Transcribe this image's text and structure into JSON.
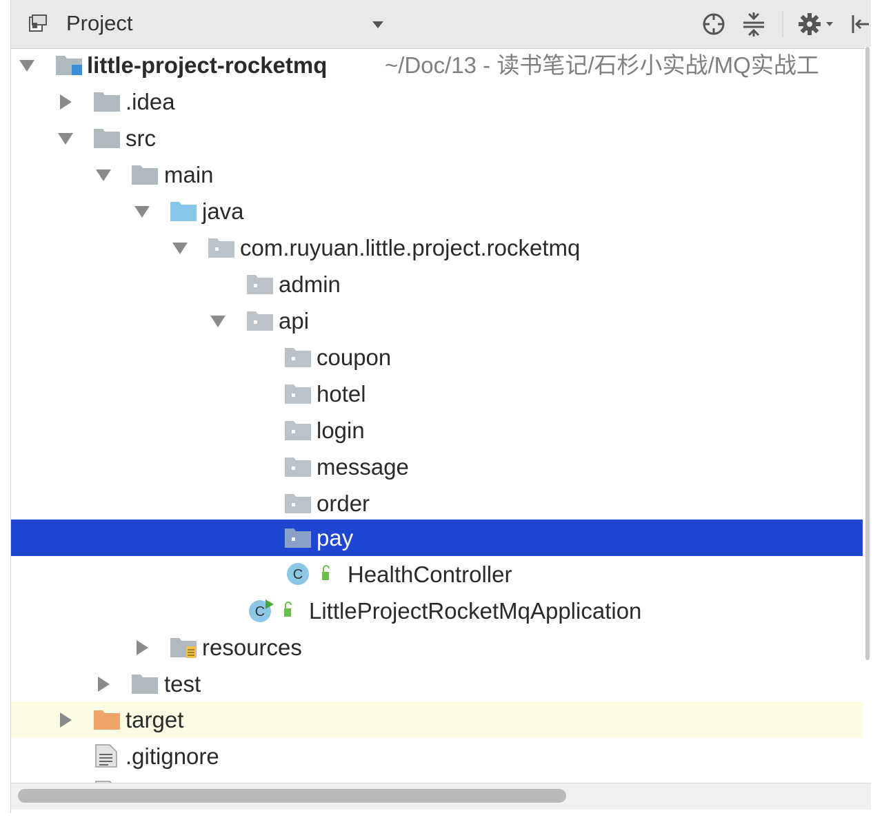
{
  "toolbar": {
    "title": "Project",
    "icons": [
      "project-view-icon",
      "dropdown-arrow-icon",
      "locate-icon",
      "collapse-all-icon",
      "gear-icon",
      "hide-panel-icon"
    ]
  },
  "tree": {
    "rows": [
      {
        "label": "little-project-rocketmq",
        "path": " ~/Doc/13 - 读书笔记/石杉小实战/MQ实战工",
        "arrow": "expanded",
        "icon": "module-folder-icon"
      },
      {
        "label": ".idea",
        "arrow": "collapsed",
        "icon": "folder-icon"
      },
      {
        "label": "src",
        "arrow": "expanded",
        "icon": "folder-icon"
      },
      {
        "label": "main",
        "arrow": "expanded",
        "icon": "folder-icon"
      },
      {
        "label": "java",
        "arrow": "expanded",
        "icon": "source-root-folder-icon"
      },
      {
        "label": "com.ruyuan.little.project.rocketmq",
        "arrow": "expanded",
        "icon": "package-icon"
      },
      {
        "label": "admin",
        "arrow": "none",
        "icon": "package-icon"
      },
      {
        "label": "api",
        "arrow": "expanded",
        "icon": "package-icon"
      },
      {
        "label": "coupon",
        "arrow": "none",
        "icon": "package-icon"
      },
      {
        "label": "hotel",
        "arrow": "none",
        "icon": "package-icon"
      },
      {
        "label": "login",
        "arrow": "none",
        "icon": "package-icon"
      },
      {
        "label": "message",
        "arrow": "none",
        "icon": "package-icon"
      },
      {
        "label": "order",
        "arrow": "none",
        "icon": "package-icon"
      },
      {
        "label": "pay",
        "arrow": "none",
        "icon": "package-icon",
        "selected": true
      },
      {
        "label": "HealthController",
        "arrow": "none",
        "icon": "java-class-icon"
      },
      {
        "label": "LittleProjectRocketMqApplication",
        "arrow": "none",
        "icon": "spring-boot-class-icon"
      },
      {
        "label": "resources",
        "arrow": "collapsed",
        "icon": "resources-folder-icon"
      },
      {
        "label": "test",
        "arrow": "collapsed",
        "icon": "folder-icon"
      },
      {
        "label": "target",
        "arrow": "collapsed",
        "icon": "excluded-folder-icon"
      },
      {
        "label": ".gitignore",
        "arrow": "none",
        "icon": "text-file-icon"
      }
    ]
  },
  "colors": {
    "selection": "#1f46d0",
    "highlight": "#fdfde6",
    "folder": "#aeb9c0",
    "source_folder": "#87c7ea",
    "excluded_folder": "#f0a46a",
    "class_circle": "#8cc8e6"
  }
}
